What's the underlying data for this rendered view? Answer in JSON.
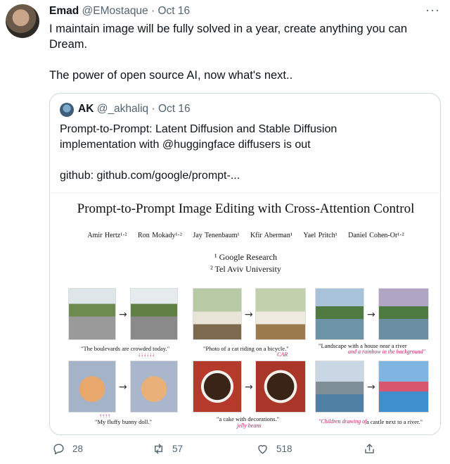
{
  "tweet": {
    "author_name": "Emad",
    "author_handle": "@EMostaque",
    "separator": "·",
    "date": "Oct 16",
    "more": "···",
    "line1": "I maintain image will be fully solved in a year, create anything you can",
    "line2": "Dream.",
    "line3": "The power of open source AI, now what's next.."
  },
  "quote": {
    "author_name": "AK",
    "author_handle": "@_akhaliq",
    "separator": "·",
    "date": "Oct 16",
    "line1": "Prompt-to-Prompt: Latent Diffusion and Stable Diffusion",
    "line2": "implementation with @huggingface diffusers is out",
    "line3": "github: github.com/google/prompt-..."
  },
  "paper": {
    "title": "Prompt-to-Prompt Image Editing with Cross-Attention Control",
    "authors": [
      "Amir Hertz¹·²",
      "Ron Mokady¹·²",
      "Jay Tenenbaum¹",
      "Kfir Aberman¹",
      "Yael Pritch¹",
      "Daniel Cohen-Or¹·²"
    ],
    "affil1": "¹ Google Research",
    "affil2": "² Tel Aviv University",
    "captions": {
      "c1": "\"The boulevards are crowded today.\"",
      "c1_edit": "↓↓↓↓↓↓",
      "c2": "\"Photo of a cat riding on a bicycle.\"",
      "c2_edit": "CAR",
      "c3": "\"Landscape with a house near a river",
      "c3_edit": "and a rainbow in the background\"",
      "c4": "\"My fluffy bunny doll.\"",
      "c4_edit": "↑↑↑↑",
      "c5": "\"a cake with decorations.\"",
      "c5_edit": "jelly beans",
      "c6_edit": "\"Children drawing of",
      "c6": "a castle next to a river.\""
    },
    "arrow": "→"
  },
  "actions": {
    "replies": "28",
    "retweets": "57",
    "likes": "518"
  },
  "colors": {
    "text": "#0f1419",
    "muted": "#536471",
    "border": "#cfd9de",
    "annotation": "#c2185b"
  }
}
